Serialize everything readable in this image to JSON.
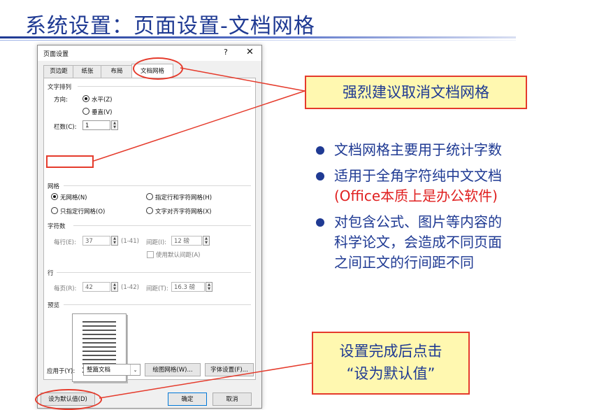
{
  "slide": {
    "title": "系统设置：页面设置-文档网格"
  },
  "dialog": {
    "title": "页面设置",
    "help": "?",
    "close": "✕",
    "tabs": [
      "页边距",
      "纸张",
      "布局",
      "文档网格"
    ],
    "active_tab": "文档网格",
    "text_direction": {
      "section": "文字排列",
      "direction_label": "方向:",
      "horizontal": "水平(Z)",
      "vertical": "垂直(V)",
      "selected": "水平(Z)",
      "columns_label": "栏数(C):",
      "columns_value": "1"
    },
    "grid": {
      "section": "网格",
      "no_grid": "无网格(N)",
      "line_and_char": "指定行和字符网格(H)",
      "line_only": "只指定行网格(O)",
      "snap_to_char": "文字对齐字符网格(X)",
      "selected": "无网格(N)"
    },
    "characters": {
      "section": "字符数",
      "per_line_label": "每行(E):",
      "per_line_value": "37",
      "per_line_range": "(1-41)",
      "pitch_label": "间距(I):",
      "pitch_value": "12 磅",
      "use_default_pitch": "使用默认间距(A)"
    },
    "lines": {
      "section": "行",
      "per_page_label": "每页(R):",
      "per_page_value": "42",
      "per_page_range": "(1-42)",
      "pitch_label": "间距(T):",
      "pitch_value": "16.3 磅"
    },
    "preview": {
      "section": "预览"
    },
    "apply_to_label": "应用于(Y):",
    "apply_to_value": "整篇文档",
    "draw_grid_button": "绘图网格(W)...",
    "font_settings_button": "字体设置(F)...",
    "set_default_button": "设为默认值(D)",
    "ok_button": "确定",
    "cancel_button": "取消"
  },
  "callouts": {
    "top": "强烈建议取消文档网格",
    "bottom_line1": "设置完成后点击",
    "bottom_line2": "“设为默认值”"
  },
  "bullets": {
    "b1": "文档网格主要用于统计字数",
    "b2_line1": "适用于全角字符纯中文文档",
    "b2_line2": "(Office本质上是办公软件)",
    "b3_line1": "对包含公式、图片等内容的",
    "b3_line2": "科学论文，会造成不同页面",
    "b3_line3": "之间正文的行间距不同"
  },
  "colors": {
    "title_blue": "#1f3a93",
    "highlight_red": "#e53b2c",
    "callout_yellow": "#fff8b0",
    "accent_red_text": "#e02020"
  }
}
